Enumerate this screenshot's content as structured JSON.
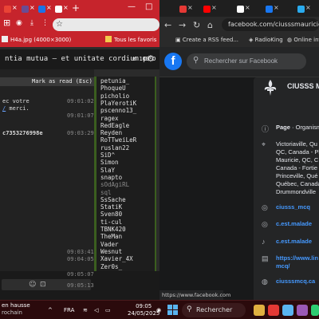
{
  "left_window": {
    "tabs": [
      {
        "icon": "gmail-icon",
        "color": "#ea4335"
      },
      {
        "icon": "app-icon",
        "color": "#6a4c93"
      },
      {
        "icon": "plus-cross-icon",
        "color": "#1a73e8"
      },
      {
        "icon": "app-icon",
        "color": "#d93025"
      },
      {
        "icon": "app-icon",
        "color": "#ffffff"
      }
    ],
    "new_tab_label": "+",
    "window_controls": [
      "—",
      "□"
    ],
    "bookmarks": [
      {
        "label": "H4a.jpg (4000×3000)",
        "icon": "image-icon"
      },
      {
        "label": "Tous les favoris",
        "icon": "folder-icon"
      }
    ],
    "chat": {
      "title": "ntia mutua — et unitate cordium pro",
      "user_count": "109",
      "read_button": "Mark as read (Esc)",
      "messages": [
        {
          "text": "ec votre",
          "time": "09:01:02",
          "link": ""
        },
        {
          "text": "",
          "link": "/",
          "suffix": " merci.",
          "time": "09:01:07"
        },
        {
          "text": "c7353276998e",
          "time": "09:03:29",
          "link": ""
        }
      ],
      "bottom_times": [
        "09:03:41",
        "09:04:05",
        "09:05:07",
        "09:05:13"
      ]
    },
    "users": [
      "petunia_",
      "PhoqueU",
      "picholio",
      "PlaYerotiK",
      "pscenno13_",
      "ragex",
      "RedEagle",
      "Reyden",
      "RoTTweiLeR",
      "ruslan22",
      "SiD^",
      "Simon",
      "SlaY",
      "snapto",
      "sOdAgiRL",
      "sql",
      "SsSache",
      "StatiK",
      "Sven80",
      "ti-cul",
      "TBNK420",
      "TheMan",
      "Vader",
      "Wesnut",
      "Xavier_4X",
      "Zer0s_"
    ],
    "dim_users": [
      "sOdAgiRL",
      "sql"
    ]
  },
  "right_window": {
    "tabs": [
      {
        "icon": "app-icon",
        "color": "#e53935"
      },
      {
        "icon": "youtube-icon",
        "color": "#ff0000"
      },
      {
        "icon": "x-icon",
        "color": "#ffffff"
      },
      {
        "icon": "app-icon",
        "color": "#1877f2"
      },
      {
        "icon": "telegram-icon",
        "color": "#2aabee"
      }
    ],
    "url": "facebook.com/ciusssmauriciece",
    "bookmarks": [
      {
        "label": "Create a RSS feed...",
        "icon": "rss-icon"
      },
      {
        "label": "RadioKing",
        "icon": "radio-icon"
      },
      {
        "label": "Online inte",
        "icon": "globe-icon"
      }
    ],
    "search_placeholder": "Rechercher sur Facebook",
    "page_name": "CIUSSS MCQ",
    "page_type_bold": "Page",
    "page_type_rest": " · Organism",
    "address_lines": [
      "Victoriaville, Qu",
      "QC, Canada - Pl",
      "Mauricie, QC, C",
      "Canada - Fortie",
      "Princeville, Qué",
      "Québec, Canada",
      "Drummondville"
    ],
    "social": [
      {
        "icon": "instagram-icon",
        "label": "ciusss_mcq"
      },
      {
        "icon": "instagram-icon",
        "label": "c.est.malade"
      },
      {
        "icon": "tiktok-icon",
        "label": "c.est.malade"
      },
      {
        "icon": "linkedin-icon",
        "label": "https://www.lin",
        "label2": "mcq/"
      },
      {
        "icon": "globe-icon",
        "label": "ciusssmcq.ca"
      }
    ],
    "status_url": "https://www.facebook.com"
  },
  "taskbar": {
    "weather_line1": "en hausse",
    "weather_line2": "rochain",
    "lang": "FRA",
    "time": "09:05",
    "date": "24/05/2025",
    "search_label": "Rechercher",
    "apps": [
      {
        "icon": "app-icon",
        "color": "#e0b040"
      },
      {
        "icon": "browser-icon",
        "color": "#e53935"
      },
      {
        "icon": "app-icon",
        "color": "#5ab4f0"
      },
      {
        "icon": "app-icon",
        "color": "#9b59b6"
      },
      {
        "icon": "app-icon",
        "color": "#2ecc71"
      }
    ]
  }
}
